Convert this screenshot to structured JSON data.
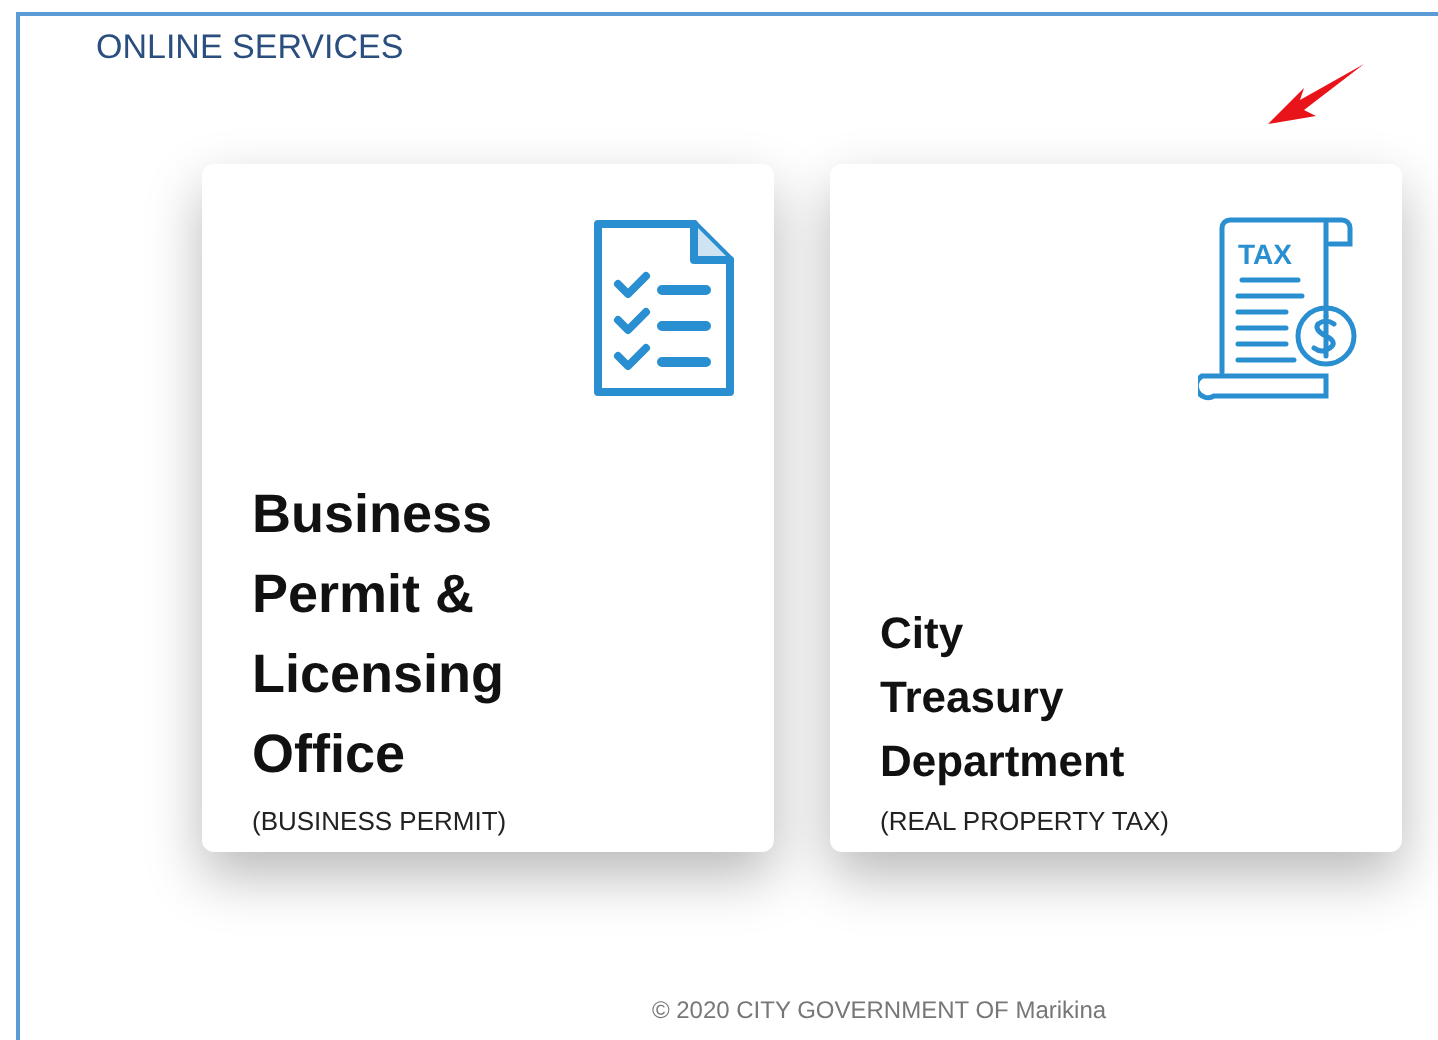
{
  "header": {
    "title": "ONLINE SERVICES"
  },
  "cards": [
    {
      "kind": "checklist",
      "title": "Business\nPermit &\nLicensing\nOffice",
      "subtitle": "(BUSINESS PERMIT)"
    },
    {
      "kind": "tax",
      "icon_text": "TAX",
      "title": "City\nTreasury\nDepartment",
      "subtitle": "(REAL PROPERTY TAX)"
    }
  ],
  "footer": {
    "text": "© 2020 CITY GOVERNMENT OF Marikina"
  }
}
